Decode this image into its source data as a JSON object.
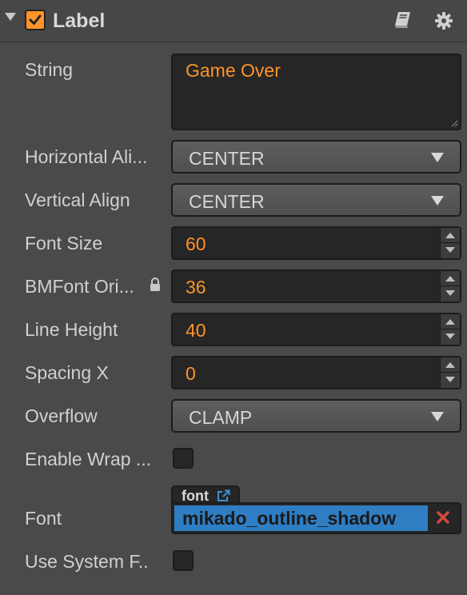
{
  "component": {
    "title": "Label",
    "enabled": true
  },
  "icons": {
    "fold": "chevron-down-icon",
    "enable": "check-icon",
    "help": "book-icon",
    "settings": "gear-icon",
    "lock": "lock-icon",
    "external": "external-link-icon",
    "clear": "close-icon"
  },
  "colors": {
    "accent": "#fd942b",
    "asset_highlight": "#2f7dc3",
    "clear": "#d04a3c"
  },
  "properties": {
    "string": {
      "label": "String",
      "value": "Game Over"
    },
    "horizontal_align": {
      "label": "Horizontal Ali...",
      "value": "CENTER"
    },
    "vertical_align": {
      "label": "Vertical Align",
      "value": "CENTER"
    },
    "font_size": {
      "label": "Font Size",
      "value": "60"
    },
    "bmfont_original_size": {
      "label": "BMFont Ori...",
      "value": "36"
    },
    "line_height": {
      "label": "Line Height",
      "value": "40"
    },
    "spacing_x": {
      "label": "Spacing X",
      "value": "0"
    },
    "overflow": {
      "label": "Overflow",
      "value": "CLAMP"
    },
    "enable_wrap_text": {
      "label": "Enable Wrap ...",
      "checked": false
    },
    "font": {
      "label": "Font",
      "asset_type": "font",
      "value": "mikado_outline_shadow"
    },
    "use_system_font": {
      "label": "Use System F..",
      "checked": false
    }
  }
}
